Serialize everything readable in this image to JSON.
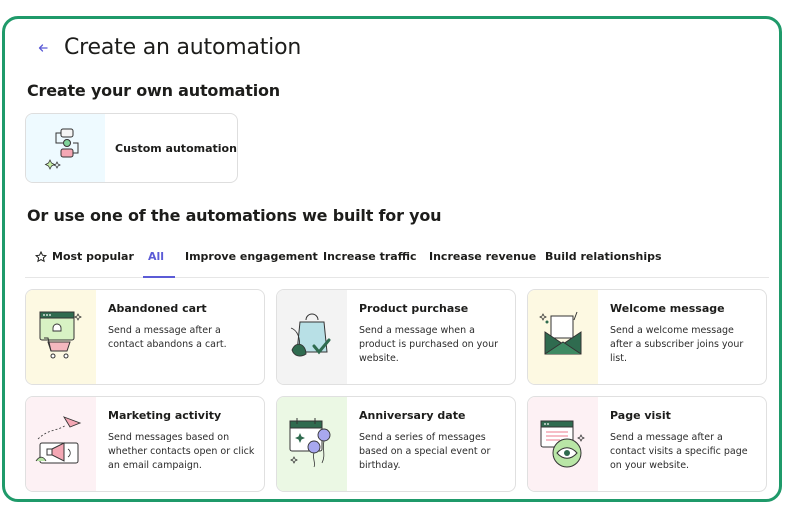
{
  "header": {
    "title": "Create an automation"
  },
  "section_own": {
    "heading": "Create your own automation",
    "custom_label": "Custom automation"
  },
  "section_built": {
    "heading": "Or use one of the automations we built for you"
  },
  "tabs": [
    {
      "label": "Most popular",
      "icon": "star-icon"
    },
    {
      "label": "All",
      "active": true
    },
    {
      "label": "Improve engagement"
    },
    {
      "label": "Increase traffic"
    },
    {
      "label": "Increase revenue"
    },
    {
      "label": "Build relationships"
    }
  ],
  "cards": [
    {
      "title": "Abandoned cart",
      "desc": "Send a message after a contact abandons a cart.",
      "bg": "#fdf9e2"
    },
    {
      "title": "Product purchase",
      "desc": "Send a message when a product is purchased on your website.",
      "bg": "#f3f3f3"
    },
    {
      "title": "Welcome message",
      "desc": "Send a welcome message after a subscriber joins your list.",
      "bg": "#fdf9e2"
    },
    {
      "title": "Marketing activity",
      "desc": "Send messages based on whether contacts open or click an email campaign.",
      "bg": "#fdf1f4"
    },
    {
      "title": "Anniversary date",
      "desc": "Send a series of messages based on a special event or birthday.",
      "bg": "#ebf8e4"
    },
    {
      "title": "Page visit",
      "desc": "Send a message after a contact visits a specific page on your website.",
      "bg": "#fdf1f4"
    }
  ],
  "colors": {
    "accent": "#5b5bd6",
    "frame": "#1f9a6a",
    "dark_green": "#2f6b4f",
    "light_green": "#b9e6a6"
  }
}
